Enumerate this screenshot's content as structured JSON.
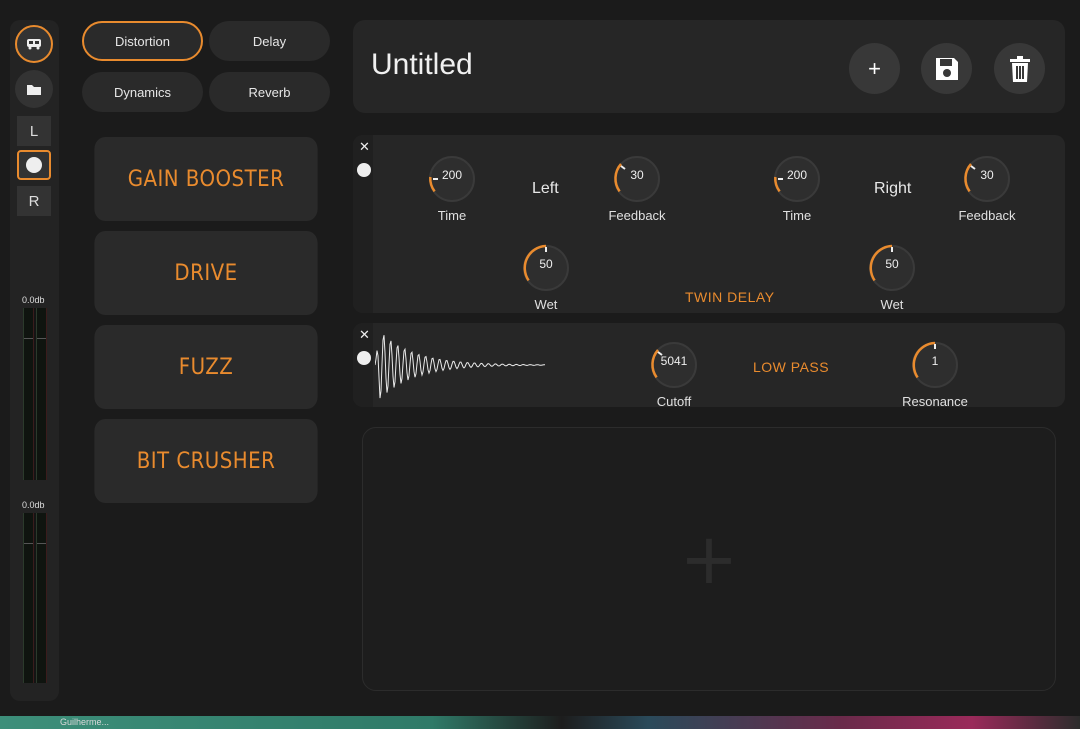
{
  "app": {
    "title": "Untitled",
    "accent": "#e98b2e"
  },
  "sidebar": {
    "buttons": [
      "bus-icon",
      "folder-icon"
    ],
    "channels": [
      "L",
      "",
      "R"
    ],
    "meters": [
      {
        "label": "0.0db"
      },
      {
        "label": "0.0db"
      }
    ]
  },
  "categories": [
    "Distortion",
    "Delay",
    "Dynamics",
    "Reverb"
  ],
  "active_category": "Distortion",
  "effects": [
    "GAIN BOOSTER",
    "DRIVE",
    "FUZZ",
    "BIT CRUSHER"
  ],
  "header": {
    "actions": [
      "add-icon",
      "save-icon",
      "trash-icon"
    ],
    "add_glyph": "+"
  },
  "chain": {
    "twin_delay": {
      "name": "TWIN DELAY",
      "close": "✕",
      "left_label": "Left",
      "right_label": "Right",
      "knobs": [
        {
          "label": "Time",
          "value": "200"
        },
        {
          "label": "Feedback",
          "value": "30"
        },
        {
          "label": "Time",
          "value": "200"
        },
        {
          "label": "Feedback",
          "value": "30"
        },
        {
          "label": "Wet",
          "value": "50"
        },
        {
          "label": "Wet",
          "value": "50"
        }
      ]
    },
    "low_pass": {
      "name": "LOW PASS",
      "close": "✕",
      "knobs": [
        {
          "label": "Cutoff",
          "value": "5041"
        },
        {
          "label": "Resonance",
          "value": "1"
        }
      ]
    },
    "dropzone_glyph": "+"
  },
  "taskbar": {
    "label": "Guilherme..."
  }
}
